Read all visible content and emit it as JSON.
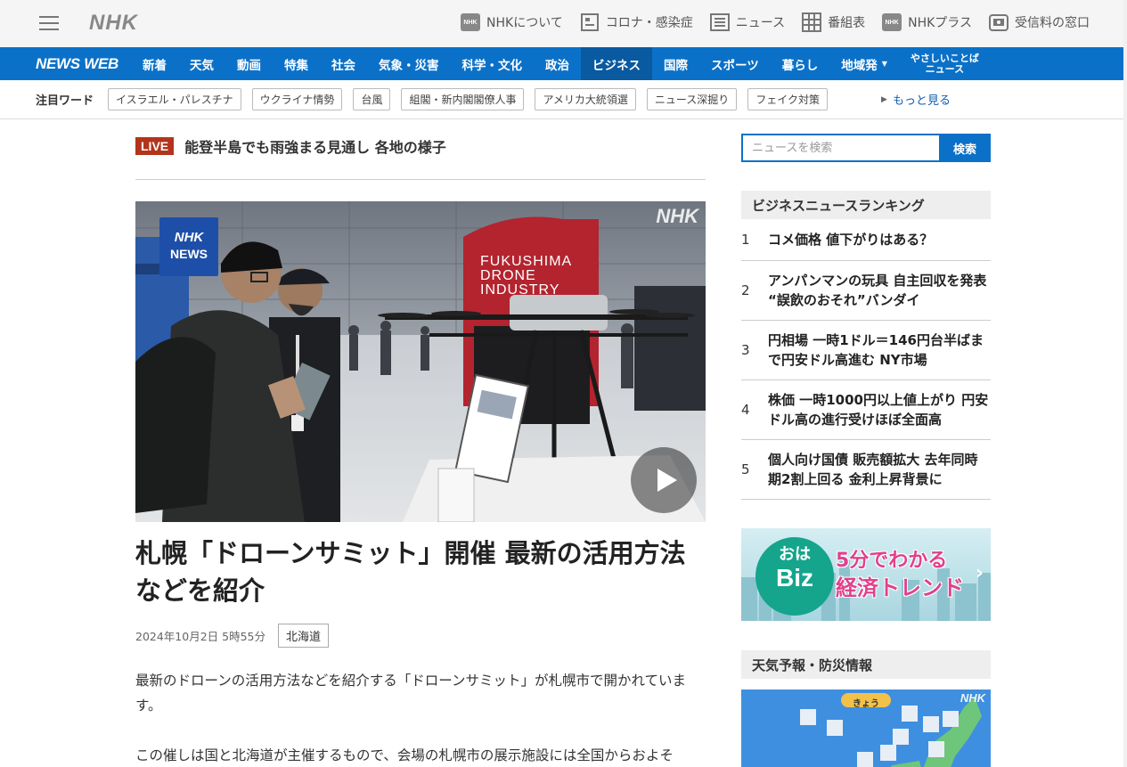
{
  "header": {
    "logo": "NHK",
    "links": [
      {
        "label": "NHKについて",
        "icon": "nhk-icon"
      },
      {
        "label": "コロナ・感染症",
        "icon": "corona-icon"
      },
      {
        "label": "ニュース",
        "icon": "news-icon"
      },
      {
        "label": "番組表",
        "icon": "grid-icon"
      },
      {
        "label": "NHKプラス",
        "icon": "nhk-plus-icon"
      },
      {
        "label": "受信料の窓口",
        "icon": "fee-window-icon"
      }
    ]
  },
  "nav": {
    "brand": "NEWS WEB",
    "items": [
      "新着",
      "天気",
      "動画",
      "特集",
      "社会",
      "気象・災害",
      "科学・文化",
      "政治",
      "ビジネス",
      "国際",
      "スポーツ",
      "暮らし",
      "地域発"
    ],
    "active": "ビジネス",
    "easy_news_line1": "やさしいことば",
    "easy_news_line2": "ニュース"
  },
  "keywords": {
    "label": "注目ワード",
    "tags": [
      "イスラエル・パレスチナ",
      "ウクライナ情勢",
      "台風",
      "組閣・新内閣閣僚人事",
      "アメリカ大統領選",
      "ニュース深掘り",
      "フェイク対策"
    ],
    "more": "もっと見る"
  },
  "live": {
    "badge": "LIVE",
    "text": "能登半島でも雨強まる見通し 各地の様子"
  },
  "hero": {
    "nhk_news_badge_line1": "NHK",
    "nhk_news_badge_line2": "NEWS",
    "watermark": "NHK",
    "sign_line1": "FUKUSHIMA",
    "sign_line2": "DRONE",
    "sign_line3": "INDUSTRY"
  },
  "article": {
    "title": "札幌「ドローンサミット」開催 最新の活用方法などを紹介",
    "date": "2024年10月2日 5時55分",
    "region_tag": "北海道",
    "paragraphs": [
      "最新のドローンの活用方法などを紹介する「ドローンサミット」が札幌市で開かれています。",
      "この催しは国と北海道が主催するもので、会場の札幌市の展示施設には全国からおよそ"
    ]
  },
  "search": {
    "placeholder": "ニュースを検索",
    "button": "検索"
  },
  "ranking": {
    "title": "ビジネスニュースランキング",
    "items": [
      {
        "rank": "1",
        "title": "コメ価格 値下がりはある？"
      },
      {
        "rank": "2",
        "title": "アンパンマンの玩具 自主回収を発表 “誤飲のおそれ”バンダイ"
      },
      {
        "rank": "3",
        "title": "円相場 一時1ドル＝146円台半ばまで円安ドル高進む NY市場"
      },
      {
        "rank": "4",
        "title": "株価 一時1000円以上値上がり 円安ドル高の進行受けほぼ全面高"
      },
      {
        "rank": "5",
        "title": "個人向け国債 販売額拡大 去年同時期2割上回る 金利上昇背景に"
      }
    ]
  },
  "ohabiz": {
    "logo_top": "おは",
    "logo_bottom": "Biz",
    "line1": "5分でわかる",
    "line2": "経済トレンド"
  },
  "weather": {
    "title": "天気予報・防災情報",
    "map_label": "きょう",
    "watermark": "NHK"
  }
}
